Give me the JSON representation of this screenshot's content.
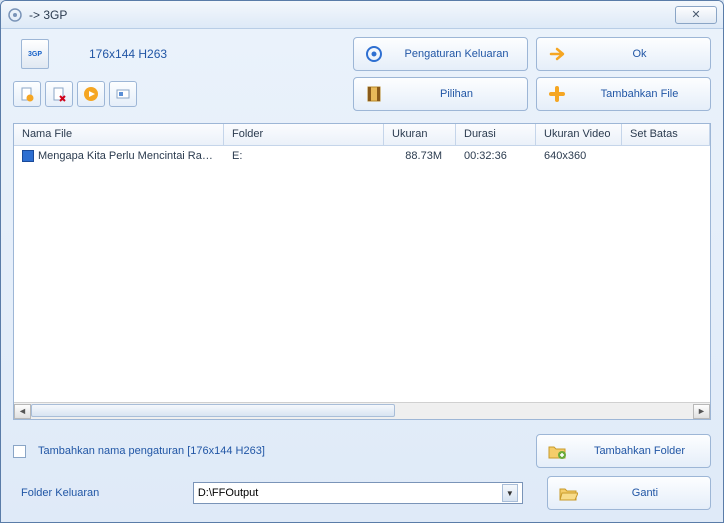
{
  "title": "-> 3GP",
  "format": {
    "icon_label": "3GP",
    "text": "176x144 H263"
  },
  "buttons": {
    "output_settings": "Pengaturan Keluaran",
    "ok": "Ok",
    "options": "Pilihan",
    "add_file": "Tambahkan File",
    "add_folder": "Tambahkan Folder",
    "change": "Ganti"
  },
  "columns": {
    "name": "Nama File",
    "folder": "Folder",
    "size": "Ukuran",
    "duration": "Durasi",
    "video_size": "Ukuran Video",
    "set_limit": "Set Batas"
  },
  "rows": [
    {
      "name": "Mengapa Kita Perlu Mencintai Rasul...",
      "folder": "E:",
      "size": "88.73M",
      "duration": "00:32:36",
      "video_size": "640x360",
      "set_limit": ""
    }
  ],
  "checkbox_label": "Tambahkan nama pengaturan [176x144 H263]",
  "output_folder_label": "Folder Keluaran",
  "output_folder_value": "D:\\FFOutput"
}
